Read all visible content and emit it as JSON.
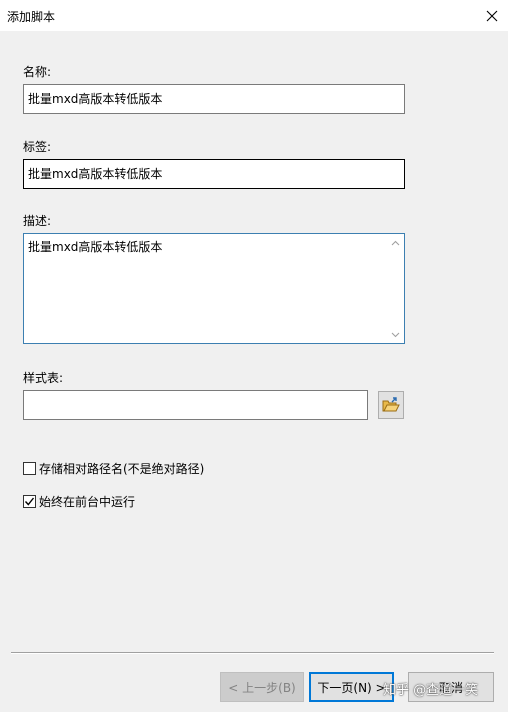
{
  "window": {
    "title": "添加脚本"
  },
  "fields": {
    "name_label": "名称:",
    "name_value": "批量mxd高版本转低版本",
    "tag_label": "标签:",
    "tag_value": "批量mxd高版本转低版本",
    "desc_label": "描述:",
    "desc_value": "批量mxd高版本转低版本",
    "stylesheet_label": "样式表:",
    "stylesheet_value": ""
  },
  "options": {
    "relative_paths": {
      "label": "存储相对路径名(不是绝对路径)",
      "checked": false
    },
    "run_foreground": {
      "label": "始终在前台中运行",
      "checked": true
    }
  },
  "buttons": {
    "back": "< 上一步(B)",
    "next": "下一页(N) >",
    "cancel": "取消"
  },
  "watermark": "知乎 @查道一笑",
  "icons": {
    "close": "close-icon",
    "folder": "folder-open-icon",
    "scroll_up": "chevron-up-icon",
    "scroll_down": "chevron-down-icon",
    "check": "check-icon"
  },
  "colors": {
    "focus_border": "#3c7fb1",
    "default_button_border": "#0078d7",
    "dialog_bg": "#f0f0f0"
  }
}
